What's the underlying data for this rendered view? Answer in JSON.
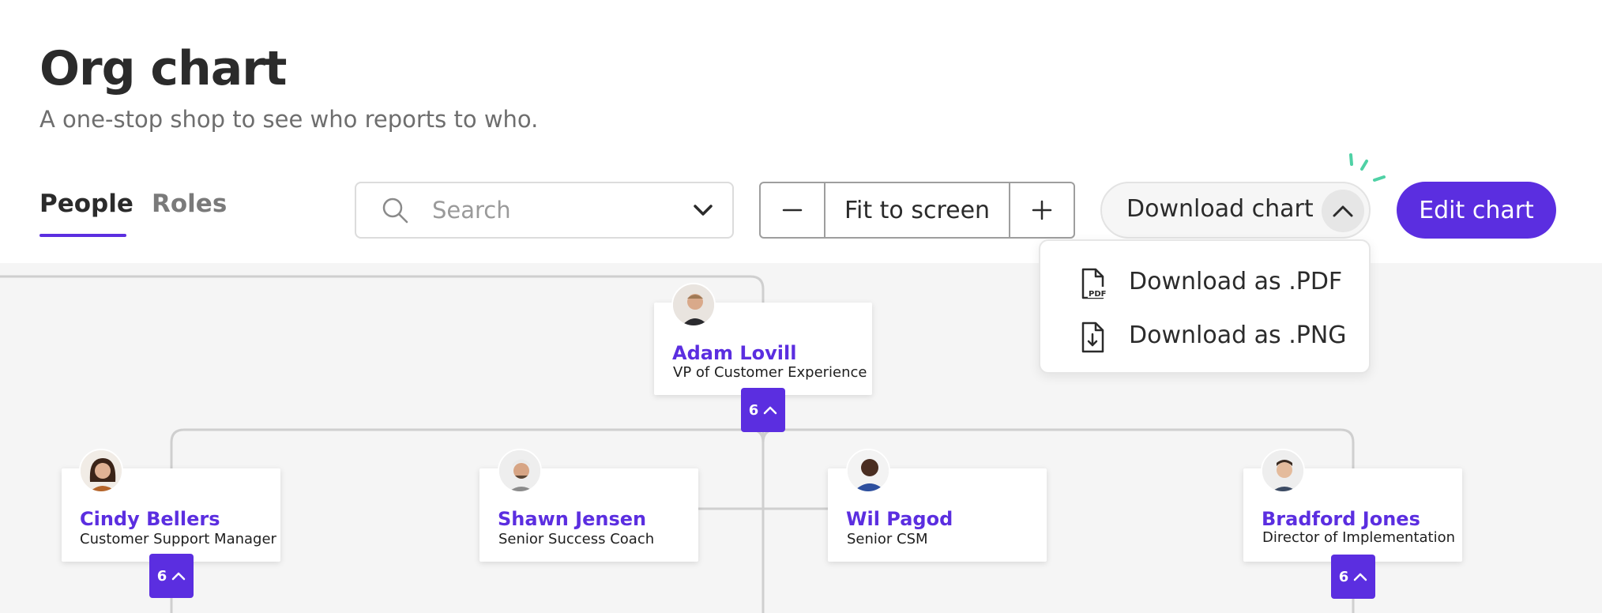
{
  "header": {
    "title": "Org chart",
    "subtitle": "A one-stop shop to see who reports to who."
  },
  "tabs": [
    {
      "label": "People",
      "active": true
    },
    {
      "label": "Roles",
      "active": false
    }
  ],
  "search": {
    "placeholder": "Search",
    "value": ""
  },
  "zoom": {
    "fit_label": "Fit to screen"
  },
  "download": {
    "label": "Download chart",
    "menu": [
      {
        "label": "Download as .PDF",
        "icon": "pdf-file-icon"
      },
      {
        "label": "Download as .PNG",
        "icon": "download-file-icon"
      }
    ]
  },
  "edit": {
    "label": "Edit chart"
  },
  "colors": {
    "accent": "#5b2ee0",
    "canvas": "#f5f5f5",
    "sparkle": "#4fd1a5"
  },
  "org": {
    "root": {
      "name": "Adam Lovill",
      "role": "VP of Customer Experience",
      "reports": "6"
    },
    "children": [
      {
        "name": "Cindy Bellers",
        "role": "Customer Support Manager",
        "reports": "6"
      },
      {
        "name": "Shawn Jensen",
        "role": "Senior Success Coach"
      },
      {
        "name": "Wil Pagod",
        "role": "Senior CSM"
      },
      {
        "name": "Bradford Jones",
        "role": "Director of Implementation",
        "reports": "6"
      }
    ]
  }
}
